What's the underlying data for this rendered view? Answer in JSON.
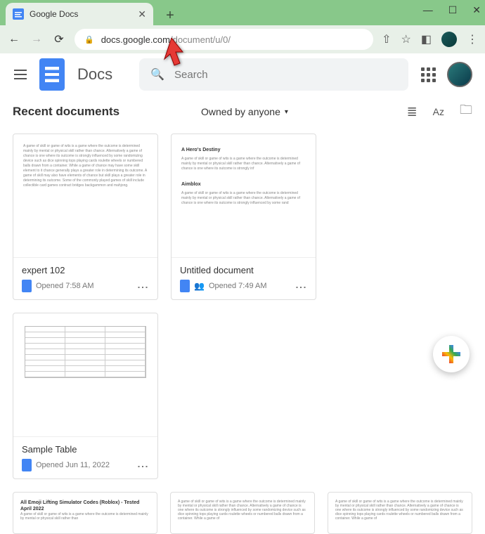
{
  "browser": {
    "tab_title": "Google Docs",
    "url_dark": "docs.google.com",
    "url_light": "/document/u/0/",
    "window_min": "—",
    "window_max": "☐",
    "window_close": "✕",
    "tab_close": "✕",
    "tab_add": "+",
    "nav_back": "←",
    "nav_fwd": "→",
    "nav_reload": "⟳",
    "lock": "🔒",
    "share": "⇧",
    "star": "☆",
    "ext": "◧",
    "menu_dots": "⋮"
  },
  "header": {
    "app_name": "Docs",
    "search_placeholder": "Search"
  },
  "subheader": {
    "recent": "Recent documents",
    "owned": "Owned by anyone",
    "owned_arrow": "▾",
    "list_icon": "☰",
    "sort_icon": "Aᴢ",
    "folder_icon": "▭"
  },
  "docs": [
    {
      "title": "expert 102",
      "opened": "Opened 7:58 AM",
      "shared": false,
      "thumb_type": "text"
    },
    {
      "title": "Untitled document",
      "opened": "Opened 7:49 AM",
      "shared": true,
      "thumb_type": "headings",
      "h1": "A Hero's Destiny",
      "h2": "Aimblox"
    },
    {
      "title": "Sample Table",
      "opened": "Opened Jun 11, 2022",
      "shared": false,
      "thumb_type": "table"
    }
  ],
  "row2": [
    {
      "title": "All Emoji Lifting Simulator Codes (Roblox) - Tested April 2022"
    },
    {
      "title": ""
    },
    {
      "title": ""
    }
  ],
  "lorem": "A game of skill or game of wits is a game where the outcome is determined mainly by mental or physical skill rather than chance. Alternatively a game of chance is one where its outcome is strongly influenced by some randomizing device such as dice spinning tops playing cards roulette wheels or numbered balls drawn from a container. While a game of chance may have some skill element to it chance generally plays a greater role in determining its outcome. A game of skill may also have elements of chance but skill plays a greater role in determining its outcome. Some of the commonly played games of skill include collectible card games contract bridges backgammon and mahjong."
}
